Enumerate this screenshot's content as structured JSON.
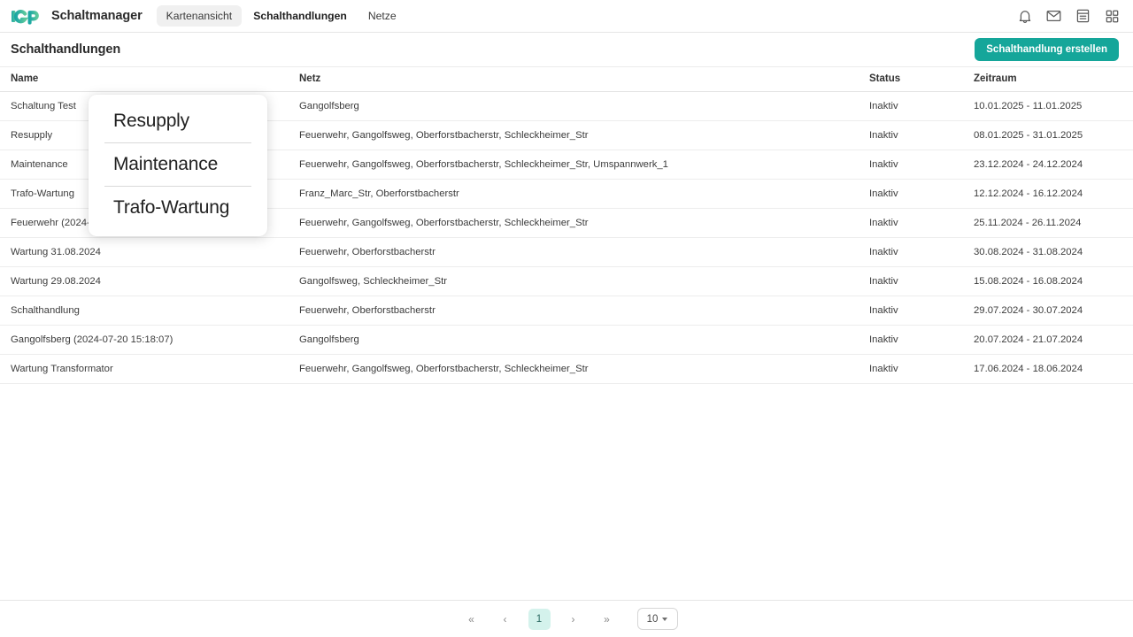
{
  "brand": {
    "logo_text": "IGP",
    "logo_colors": [
      "#1fa9a0",
      "#57c9a0"
    ],
    "app_title": "Schaltmanager"
  },
  "nav": {
    "tabs": [
      {
        "label": "Kartenansicht",
        "state": "pill"
      },
      {
        "label": "Schalthandlungen",
        "state": "active"
      },
      {
        "label": "Netze",
        "state": "normal"
      }
    ]
  },
  "topicons": [
    {
      "name": "bell-icon",
      "label": "Benachrichtigungen"
    },
    {
      "name": "mail-icon",
      "label": "Nachrichten"
    },
    {
      "name": "document-icon",
      "label": "Dokumente"
    },
    {
      "name": "apps-grid-icon",
      "label": "Apps"
    }
  ],
  "page": {
    "title": "Schalthandlungen",
    "create_button": "Schalthandlung erstellen",
    "accent_color": "#15a69a"
  },
  "table": {
    "columns": [
      "Name",
      "Netz",
      "Status",
      "Zeitraum"
    ],
    "rows": [
      {
        "name": "Schaltung Test",
        "netz": "Gangolfsberg",
        "status": "Inaktiv",
        "zeitraum": "10.01.2025 - 11.01.2025"
      },
      {
        "name": "Resupply",
        "netz": "Feuerwehr, Gangolfsweg, Oberforstbacherstr, Schleckheimer_Str",
        "status": "Inaktiv",
        "zeitraum": "08.01.2025 - 31.01.2025"
      },
      {
        "name": "Maintenance",
        "netz": "Feuerwehr, Gangolfsweg, Oberforstbacherstr, Schleckheimer_Str, Umspannwerk_1",
        "status": "Inaktiv",
        "zeitraum": "23.12.2024 - 24.12.2024"
      },
      {
        "name": "Trafo-Wartung",
        "netz": "Franz_Marc_Str, Oberforstbacherstr",
        "status": "Inaktiv",
        "zeitraum": "12.12.2024 - 16.12.2024"
      },
      {
        "name": "Feuerwehr (2024-11",
        "netz": "Feuerwehr, Gangolfsweg, Oberforstbacherstr, Schleckheimer_Str",
        "status": "Inaktiv",
        "zeitraum": "25.11.2024 - 26.11.2024"
      },
      {
        "name": "Wartung 31.08.2024",
        "netz": "Feuerwehr, Oberforstbacherstr",
        "status": "Inaktiv",
        "zeitraum": "30.08.2024 - 31.08.2024"
      },
      {
        "name": "Wartung 29.08.2024",
        "netz": "Gangolfsweg, Schleckheimer_Str",
        "status": "Inaktiv",
        "zeitraum": "15.08.2024 - 16.08.2024"
      },
      {
        "name": "Schalthandlung",
        "netz": "Feuerwehr, Oberforstbacherstr",
        "status": "Inaktiv",
        "zeitraum": "29.07.2024 - 30.07.2024"
      },
      {
        "name": "Gangolfsberg (2024-07-20 15:18:07)",
        "netz": "Gangolfsberg",
        "status": "Inaktiv",
        "zeitraum": "20.07.2024 - 21.07.2024"
      },
      {
        "name": "Wartung Transformator",
        "netz": "Feuerwehr, Gangolfsweg, Oberforstbacherstr, Schleckheimer_Str",
        "status": "Inaktiv",
        "zeitraum": "17.06.2024 - 18.06.2024"
      }
    ]
  },
  "popup": {
    "items": [
      {
        "label": "Resupply"
      },
      {
        "label": "Maintenance"
      },
      {
        "label": "Trafo-Wartung"
      }
    ]
  },
  "pagination": {
    "first_label": "«",
    "prev_label": "‹",
    "next_label": "›",
    "last_label": "»",
    "current_page": "1",
    "page_size": "10"
  }
}
